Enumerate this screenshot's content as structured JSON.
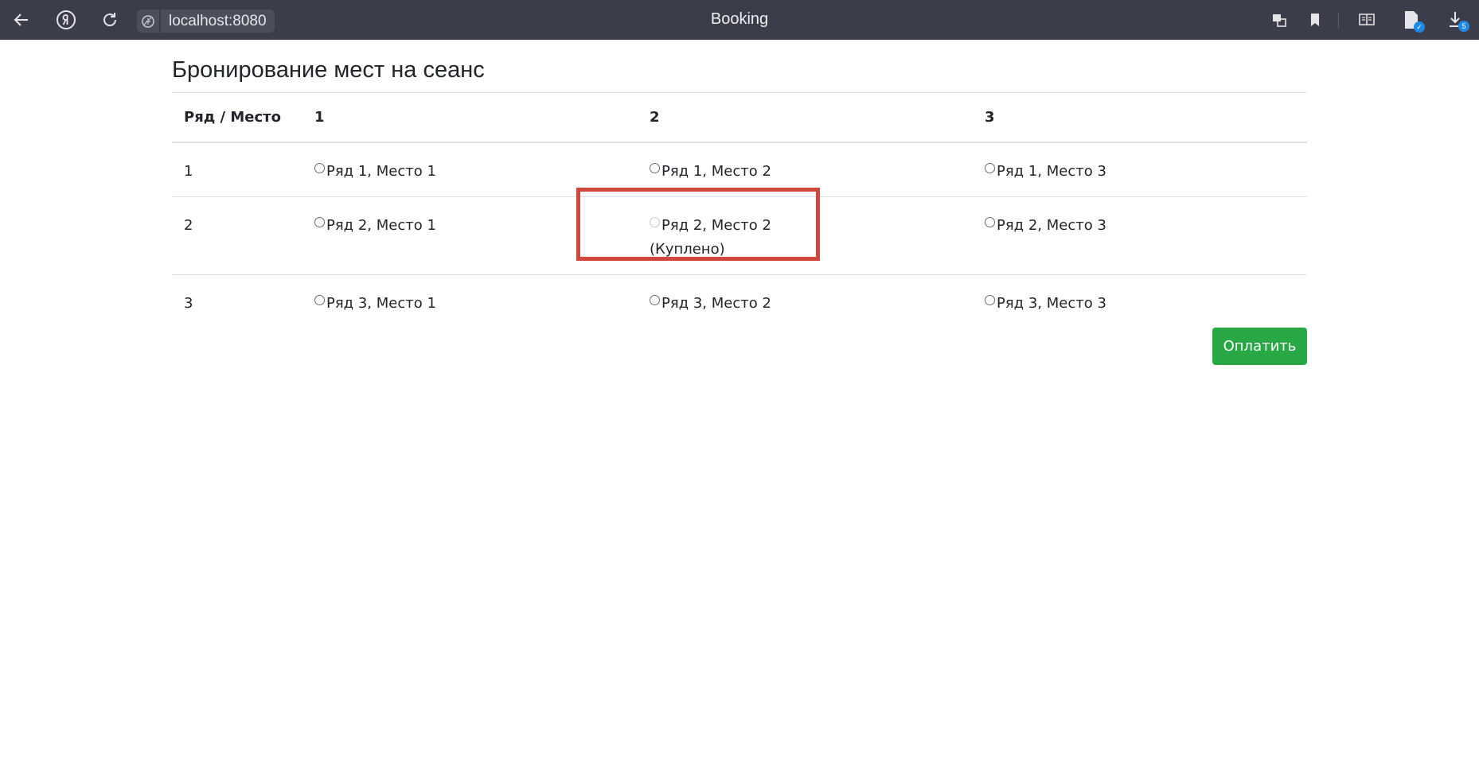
{
  "browser": {
    "url": "localhost:8080",
    "tab_title": "Booking",
    "downloads_count": "5"
  },
  "page": {
    "title": "Бронирование мест на сеанс",
    "table": {
      "headers": [
        "Ряд / Место",
        "1",
        "2",
        "3"
      ],
      "rows": [
        {
          "row_label": "1",
          "seats": [
            {
              "label": "Ряд 1, Место 1"
            },
            {
              "label": "Ряд 1, Место 2"
            },
            {
              "label": "Ряд 1, Место 3"
            }
          ]
        },
        {
          "row_label": "2",
          "seats": [
            {
              "label": "Ряд 2, Место 1"
            },
            {
              "label": "Ряд 2, Место 2",
              "status": "(Куплено)",
              "disabled": true
            },
            {
              "label": "Ряд 2, Место 3"
            }
          ]
        },
        {
          "row_label": "3",
          "seats": [
            {
              "label": "Ряд 3, Место 1"
            },
            {
              "label": "Ряд 3, Место 2"
            },
            {
              "label": "Ряд 3, Место 3"
            }
          ]
        }
      ]
    },
    "pay_button": "Оплатить"
  },
  "colors": {
    "pay_button": "#28a745",
    "highlight_border": "#d1473e",
    "chrome_bg": "#3b3d4a"
  }
}
